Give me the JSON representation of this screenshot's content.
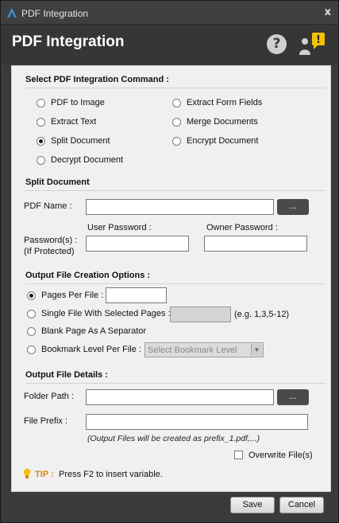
{
  "window": {
    "title": "PDF Integration",
    "close_glyph": "x"
  },
  "header": {
    "title": "PDF Integration",
    "help_glyph": "?",
    "alert_glyph": "!"
  },
  "commands": {
    "title": "Select PDF Integration Command :",
    "options": [
      {
        "label": "PDF to Image",
        "selected": false
      },
      {
        "label": "Extract Form Fields",
        "selected": false
      },
      {
        "label": "Extract Text",
        "selected": false
      },
      {
        "label": "Merge Documents",
        "selected": false
      },
      {
        "label": "Split Document",
        "selected": true
      },
      {
        "label": "Encrypt Document",
        "selected": false
      },
      {
        "label": "Decrypt Document",
        "selected": false
      }
    ]
  },
  "split": {
    "title": "Split Document",
    "pdf_name_label": "PDF Name :",
    "pdf_name_value": "",
    "browse_label": "...",
    "user_password_label": "User Password :",
    "owner_password_label": "Owner Password :",
    "password_label_1": "Password(s) :",
    "password_label_2": "(If Protected)"
  },
  "output_options": {
    "title": "Output File Creation Options :",
    "pages_per_file": "Pages Per File :",
    "single_file": "Single File With Selected Pages :",
    "example": "(e.g. 1,3,5-12)",
    "blank_page": "Blank Page As A Separator",
    "bookmark_level": "Bookmark Level Per File :",
    "bookmark_placeholder": "Select Bookmark Level",
    "selected_option": "pages_per_file"
  },
  "output_details": {
    "title": "Output File Details :",
    "folder_path_label": "Folder Path :",
    "browse_label": "...",
    "file_prefix_label": "File Prefix :",
    "note": "(Output Files will be created as prefix_1.pdf,...)",
    "overwrite_label": "Overwrite File(s)",
    "overwrite_checked": false
  },
  "tip": {
    "key": "TIP :",
    "text": "Press F2 to insert variable."
  },
  "footer": {
    "save_label": "Save",
    "cancel_label": "Cancel"
  },
  "colors": {
    "tip_accent": "#d98b00",
    "alert_badge": "#f2c200",
    "logo": "#3b8fd6"
  }
}
